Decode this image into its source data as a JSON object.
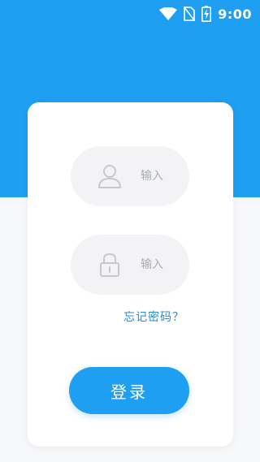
{
  "status_bar": {
    "time": "9:00",
    "icons": [
      "wifi-icon",
      "no-sim-icon",
      "battery-charging-icon"
    ]
  },
  "login_form": {
    "username": {
      "icon": "user-icon",
      "placeholder": "输入",
      "value": ""
    },
    "password": {
      "icon": "lock-icon",
      "placeholder": "输入",
      "value": ""
    },
    "forgot_password_label": "忘记密码？",
    "login_button_label": "登录"
  },
  "colors": {
    "brand_blue": "#1e9ff2",
    "link_blue": "#2a8bd0",
    "input_bg": "#f3f3f5",
    "icon_gray": "#c5c9ce"
  }
}
